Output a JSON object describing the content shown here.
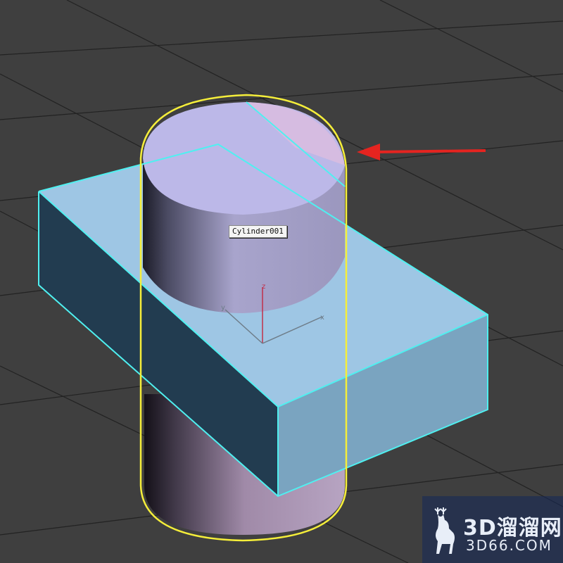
{
  "viewport": {
    "background": "#3f3f3f",
    "grid_color": "#2a2a2a"
  },
  "objects": {
    "cylinder": {
      "name": "Cylinder001",
      "selection_color": "#f5ee3a",
      "top_color": "#bcb8e8",
      "side_color": "#a49cc8"
    },
    "box": {
      "color": "#9ec6e4",
      "side_front_color": "#7aa4c0",
      "side_left_color": "#223c50",
      "selection_color": "#4ff0f0"
    }
  },
  "gizmo": {
    "z_label": "z",
    "y_label": "y",
    "x_label": "x",
    "z_color": "#c0304a",
    "xy_color": "#6e7c88"
  },
  "annotation": {
    "arrow_color": "#e52420",
    "icon": "red-arrow-icon"
  },
  "watermark": {
    "cn_text": "3D溜溜网",
    "url_text": "3D66.COM",
    "icon": "deer-logo-icon"
  }
}
